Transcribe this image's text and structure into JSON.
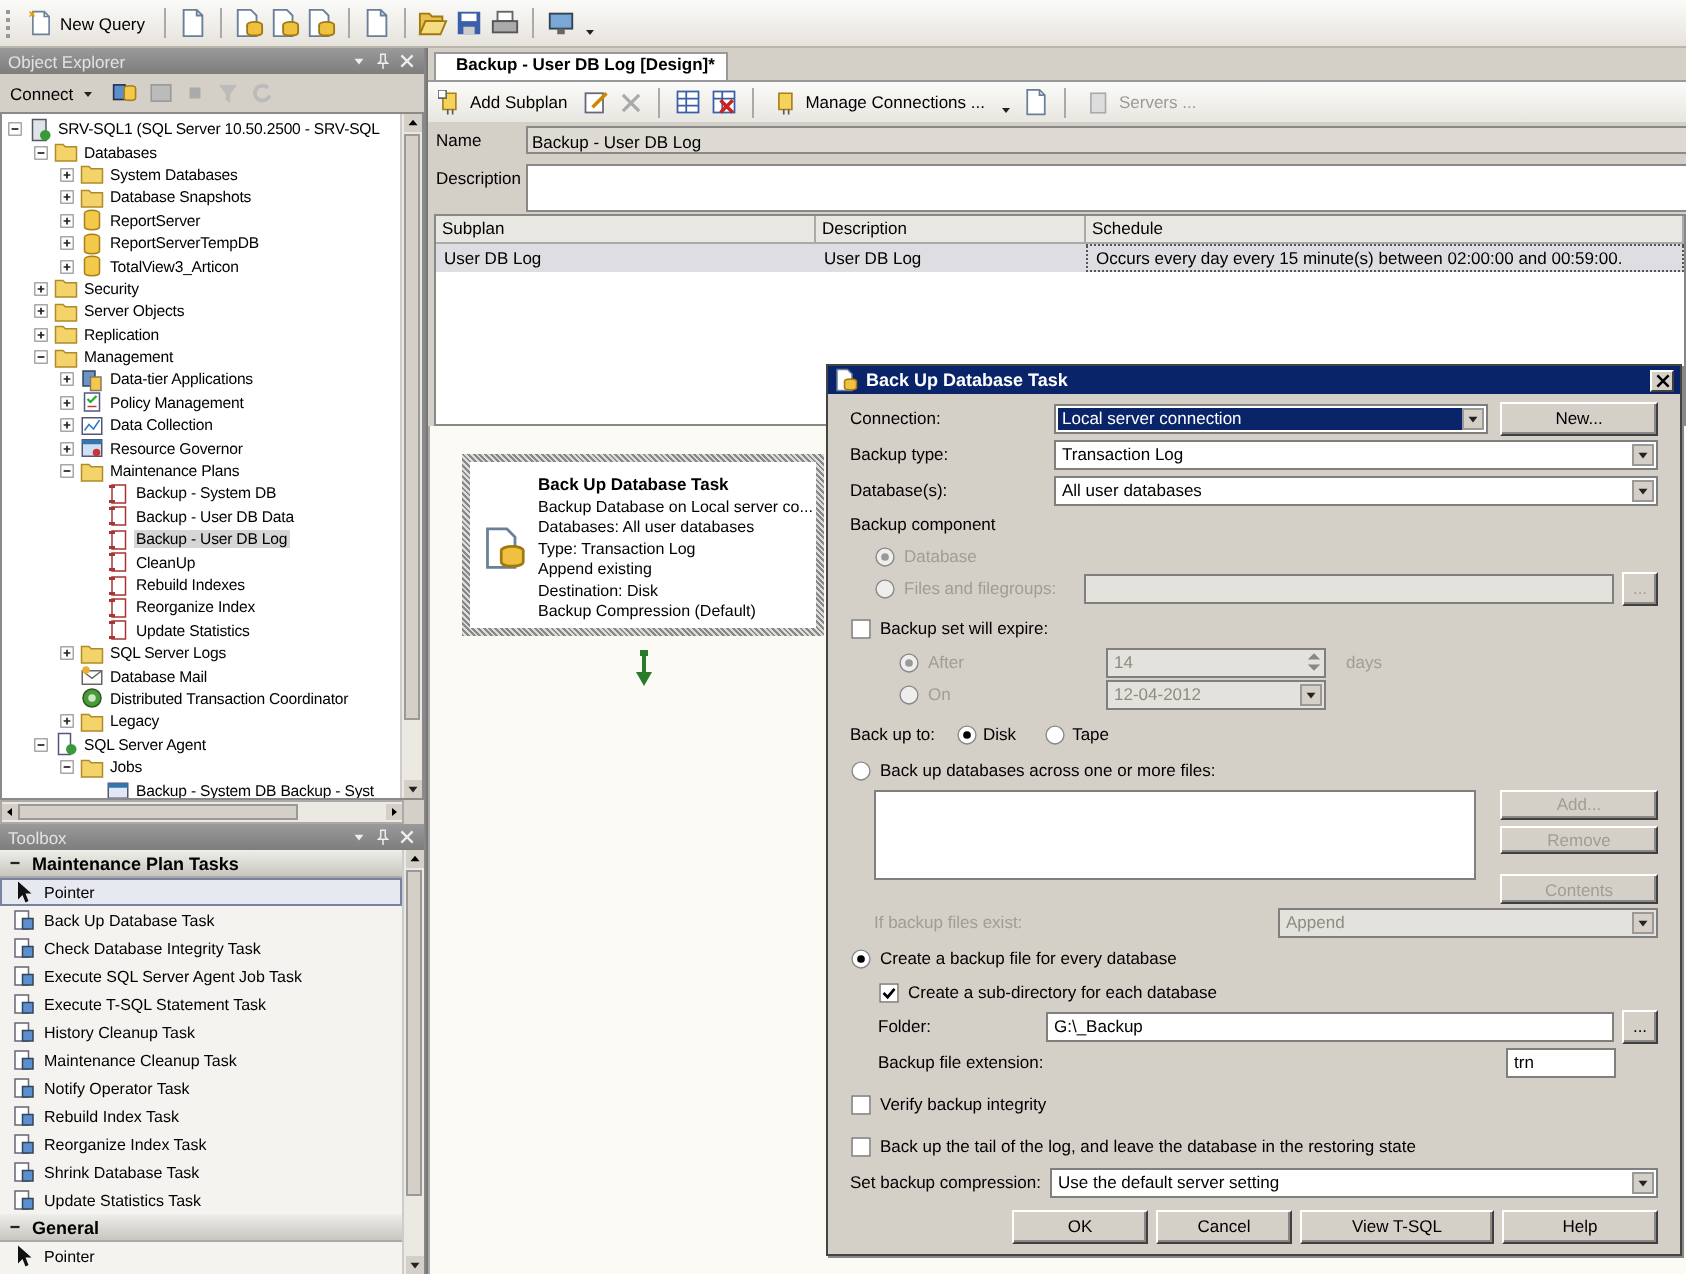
{
  "toolbar": {
    "new_query": "New Query"
  },
  "object_explorer": {
    "title": "Object Explorer",
    "connect": "Connect",
    "tree": [
      {
        "label": "SRV-SQL1 (SQL Server 10.50.2500 - SRV-SQL",
        "kind": "server",
        "expanded": true,
        "selected": false,
        "children": [
          {
            "label": "Databases",
            "kind": "folder",
            "expanded": true,
            "selected": false,
            "children": [
              {
                "label": "System Databases",
                "kind": "folder",
                "expanded": false,
                "selected": false
              },
              {
                "label": "Database Snapshots",
                "kind": "folder",
                "expanded": false,
                "selected": false
              },
              {
                "label": "ReportServer",
                "kind": "database",
                "expanded": false,
                "selected": false
              },
              {
                "label": "ReportServerTempDB",
                "kind": "database",
                "expanded": false,
                "selected": false
              },
              {
                "label": "TotalView3_Articon",
                "kind": "database",
                "expanded": false,
                "selected": false
              }
            ]
          },
          {
            "label": "Security",
            "kind": "folder",
            "expanded": false,
            "selected": false
          },
          {
            "label": "Server Objects",
            "kind": "folder",
            "expanded": false,
            "selected": false
          },
          {
            "label": "Replication",
            "kind": "folder",
            "expanded": false,
            "selected": false
          },
          {
            "label": "Management",
            "kind": "folder",
            "expanded": true,
            "selected": false,
            "children": [
              {
                "label": "Data-tier Applications",
                "kind": "app",
                "expanded": false,
                "selected": false
              },
              {
                "label": "Policy Management",
                "kind": "policy",
                "expanded": false,
                "selected": false
              },
              {
                "label": "Data Collection",
                "kind": "chart",
                "expanded": false,
                "selected": false
              },
              {
                "label": "Resource Governor",
                "kind": "governor",
                "expanded": false,
                "selected": false
              },
              {
                "label": "Maintenance Plans",
                "kind": "folder",
                "expanded": true,
                "selected": false,
                "children": [
                  {
                    "label": "Backup - System DB",
                    "kind": "plan",
                    "selected": false
                  },
                  {
                    "label": "Backup - User DB Data",
                    "kind": "plan",
                    "selected": false
                  },
                  {
                    "label": "Backup - User DB Log",
                    "kind": "plan",
                    "selected": true
                  },
                  {
                    "label": "CleanUp",
                    "kind": "plan",
                    "selected": false
                  },
                  {
                    "label": "Rebuild Indexes",
                    "kind": "plan",
                    "selected": false
                  },
                  {
                    "label": "Reorganize Index",
                    "kind": "plan",
                    "selected": false
                  },
                  {
                    "label": "Update Statistics",
                    "kind": "plan",
                    "selected": false
                  }
                ]
              },
              {
                "label": "SQL Server Logs",
                "kind": "folder",
                "expanded": false,
                "selected": false
              },
              {
                "label": "Database Mail",
                "kind": "mail",
                "selected": false
              },
              {
                "label": "Distributed Transaction Coordinator",
                "kind": "dtc",
                "selected": false
              },
              {
                "label": "Legacy",
                "kind": "folder",
                "expanded": false,
                "selected": false
              }
            ]
          },
          {
            "label": "SQL Server Agent",
            "kind": "agent",
            "expanded": true,
            "selected": false,
            "children": [
              {
                "label": "Jobs",
                "kind": "folder",
                "expanded": true,
                "selected": false,
                "children": [
                  {
                    "label": "Backup - System DB Backup - Syst",
                    "kind": "job",
                    "selected": false
                  }
                ]
              }
            ]
          }
        ]
      }
    ]
  },
  "toolbox": {
    "title": "Toolbox",
    "groups": [
      {
        "label": "Maintenance Plan Tasks",
        "expanded": true,
        "items": [
          {
            "label": "Pointer",
            "kind": "pointer",
            "selected": true
          },
          {
            "label": "Back Up Database Task",
            "kind": "task",
            "selected": false
          },
          {
            "label": "Check Database Integrity Task",
            "kind": "task",
            "selected": false
          },
          {
            "label": "Execute SQL Server Agent Job Task",
            "kind": "task",
            "selected": false
          },
          {
            "label": "Execute T-SQL Statement Task",
            "kind": "task",
            "selected": false
          },
          {
            "label": "History Cleanup Task",
            "kind": "task",
            "selected": false
          },
          {
            "label": "Maintenance Cleanup Task",
            "kind": "task",
            "selected": false
          },
          {
            "label": "Notify Operator Task",
            "kind": "task",
            "selected": false
          },
          {
            "label": "Rebuild Index Task",
            "kind": "task",
            "selected": false
          },
          {
            "label": "Reorganize Index Task",
            "kind": "task",
            "selected": false
          },
          {
            "label": "Shrink Database Task",
            "kind": "task",
            "selected": false
          },
          {
            "label": "Update Statistics Task",
            "kind": "task",
            "selected": false
          }
        ]
      },
      {
        "label": "General",
        "expanded": true,
        "items": [
          {
            "label": "Pointer",
            "kind": "pointer",
            "selected": false
          }
        ]
      }
    ]
  },
  "document_tab": {
    "label": "Backup - User DB Log [Design]*",
    "selected": true
  },
  "designer_toolbar": [
    {
      "label": "Add Subplan",
      "disabled": false
    },
    {
      "label": "Manage Connections ...",
      "disabled": false
    },
    {
      "label": "Servers ...",
      "disabled": true
    }
  ],
  "plan": {
    "name_label": "Name",
    "name_value": "Backup - User DB Log",
    "description_label": "Description"
  },
  "subplans": {
    "columns": [
      "Subplan",
      "Description",
      "Schedule"
    ],
    "rows": [
      {
        "cells": [
          "User DB Log",
          "User DB Log",
          "Occurs every day every 15 minute(s) between 02:00:00 and 00:59:00."
        ],
        "selected": true
      }
    ]
  },
  "task": {
    "title": "Back Up Database Task",
    "lines": [
      "Backup Database on Local server co...",
      "Databases: All user databases",
      "Type: Transaction Log",
      "Append existing",
      "Destination: Disk",
      "Backup Compression (Default)"
    ]
  },
  "dialog": {
    "title": "Back Up Database Task",
    "connection": {
      "label": "Connection:",
      "value": "Local server connection",
      "highlighted": true,
      "button": "New..."
    },
    "backup_type": {
      "label": "Backup type:",
      "value": "Transaction Log"
    },
    "databases": {
      "label": "Database(s):",
      "value": "All user databases"
    },
    "backup_component": {
      "label": "Backup component",
      "options": [
        {
          "label": "Database",
          "selected": true,
          "disabled": true
        },
        {
          "label": "Files and filegroups:",
          "selected": false,
          "disabled": true
        }
      ],
      "browse_button": {
        "label": "...",
        "disabled": true
      }
    },
    "expire": {
      "label": "Backup set will expire:",
      "checked": false,
      "options": [
        {
          "label": "After",
          "kind": "spin",
          "value": "14",
          "unit": "days",
          "selected": true,
          "disabled": true
        },
        {
          "label": "On",
          "kind": "date",
          "value": "12-04-2012",
          "selected": false,
          "disabled": true
        }
      ]
    },
    "back_up_to": {
      "label": "Back up to:",
      "options": [
        {
          "label": "Disk",
          "selected": true
        },
        {
          "label": "Tape",
          "selected": false
        }
      ]
    },
    "across_files": {
      "label": "Back up databases across one or more files:",
      "selected": false,
      "buttons": [
        {
          "label": "Add...",
          "disabled": true
        },
        {
          "label": "Remove",
          "disabled": true
        },
        {
          "label": "Contents",
          "disabled": true
        }
      ],
      "if_exists": {
        "label": "If backup files exist:",
        "value": "Append",
        "disabled": true
      }
    },
    "per_database": {
      "label": "Create a backup file for every database",
      "selected": true,
      "subdirectory": {
        "label": "Create a sub-directory for each database",
        "checked": true
      },
      "folder": {
        "label": "Folder:",
        "value": "G:\\_Backup",
        "browse_button": "..."
      },
      "extension": {
        "label": "Backup file extension:",
        "value": "trn"
      }
    },
    "verify": {
      "label": "Verify backup integrity",
      "checked": false
    },
    "tail_log": {
      "label": "Back up the tail of the log, and leave the database in the restoring state",
      "checked": false
    },
    "compression": {
      "label": "Set backup compression:",
      "value": "Use the default server setting"
    },
    "buttons": [
      {
        "label": "OK"
      },
      {
        "label": "Cancel"
      },
      {
        "label": "View T-SQL"
      },
      {
        "label": "Help"
      }
    ]
  }
}
